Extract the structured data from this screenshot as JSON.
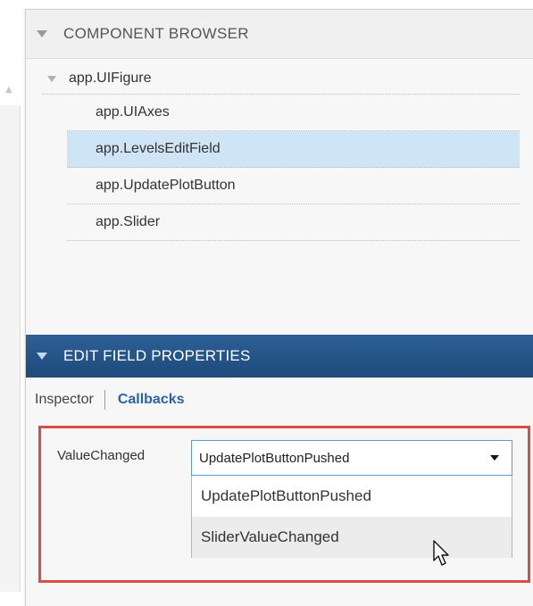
{
  "component_browser": {
    "title": "COMPONENT BROWSER",
    "root": "app.UIFigure",
    "items": [
      {
        "label": "app.UIAxes",
        "selected": false
      },
      {
        "label": "app.LevelsEditField",
        "selected": true
      },
      {
        "label": "app.UpdatePlotButton",
        "selected": false
      },
      {
        "label": "app.Slider",
        "selected": false
      }
    ]
  },
  "properties": {
    "title": "EDIT FIELD PROPERTIES",
    "tabs": {
      "inspector": "Inspector",
      "callbacks": "Callbacks",
      "active": "Callbacks"
    }
  },
  "callbacks": {
    "label": "ValueChanged",
    "selected_value": "UpdatePlotButtonPushed",
    "options": [
      "UpdatePlotButtonPushed",
      "SliderValueChanged"
    ],
    "hovered_option": "SliderValueChanged"
  },
  "icons": {
    "collapse": "triangle-down-icon",
    "dropdown": "caret-down-icon",
    "pointer": "mouse-pointer-icon"
  },
  "colors": {
    "header_blue": "#1e4a7c",
    "selection": "#cfe4f5",
    "callbacks_link": "#2a62a8",
    "highlight_border": "#e04a45",
    "focus_border": "#5b9bd5"
  }
}
